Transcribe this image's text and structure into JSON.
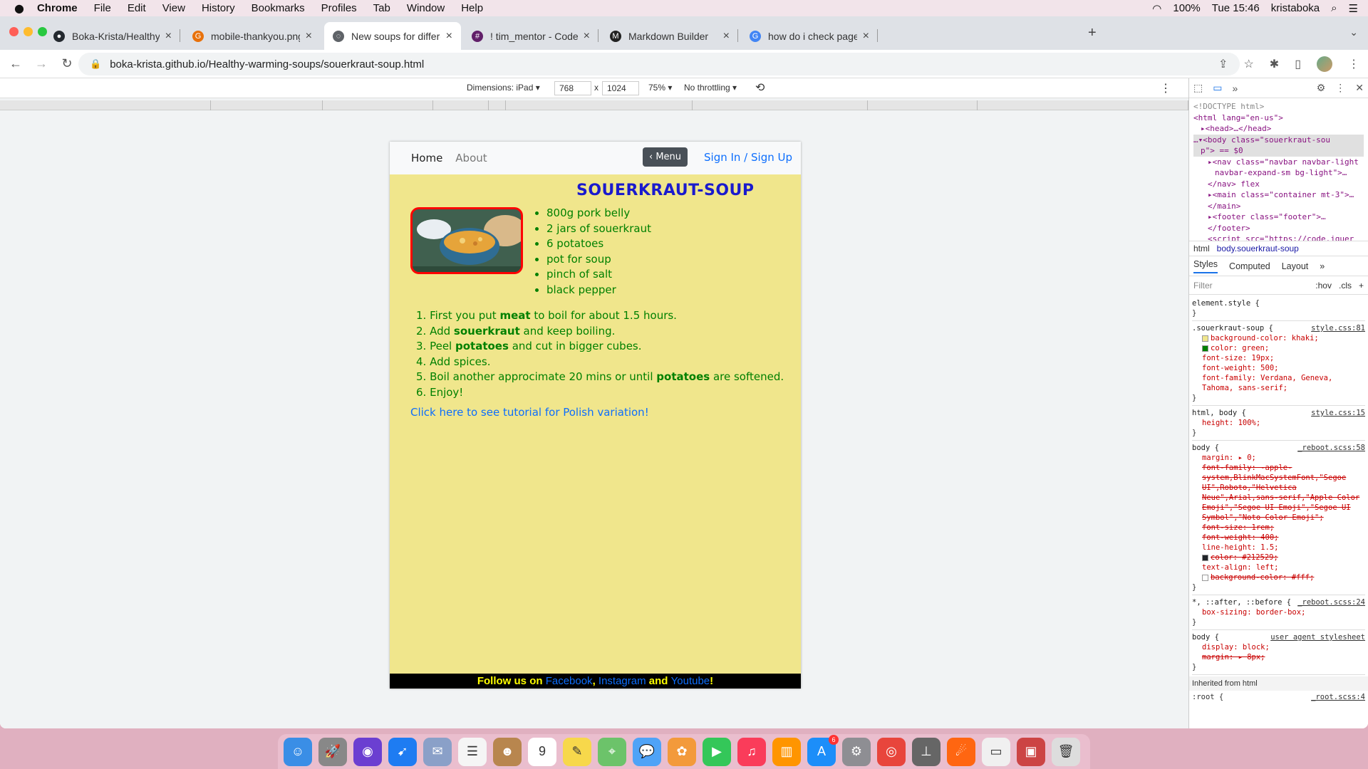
{
  "menubar": {
    "items": [
      "Chrome",
      "File",
      "Edit",
      "View",
      "History",
      "Bookmarks",
      "Profiles",
      "Tab",
      "Window",
      "Help"
    ],
    "battery": "100%",
    "clock": "Tue 15:46",
    "user": "kristaboka"
  },
  "tabs": [
    {
      "title": "Boka-Krista/Healthy-warming-",
      "color": "#24292f",
      "glyph": "●"
    },
    {
      "title": "mobile-thankyou.png — Healt",
      "color": "#e8710a",
      "glyph": "G"
    },
    {
      "title": "New soups for different tastes",
      "color": "#5f6368",
      "glyph": "◌"
    },
    {
      "title": "! tim_mentor - Code Institute -",
      "color": "#611f69",
      "glyph": "#"
    },
    {
      "title": "Markdown Builder",
      "color": "#222",
      "glyph": "M"
    },
    {
      "title": "how do i check page on excel a",
      "color": "#4285f4",
      "glyph": "G"
    }
  ],
  "address": "boka-krista.github.io/Healthy-warming-soups/souerkraut-soup.html",
  "device_bar": {
    "dimensions_label": "Dimensions: iPad ▾",
    "width": "768",
    "times": "x",
    "height": "1024",
    "zoom": "75% ▾",
    "throttling": "No throttling ▾"
  },
  "site": {
    "nav": {
      "home": "Home",
      "about": "About",
      "menu": "‹ Menu",
      "sign": "Sign In / Sign Up"
    },
    "title": "SOUERKRAUT-SOUP",
    "ingredients": [
      "800g pork belly",
      "2 jars of souerkraut",
      "6 potatoes",
      "pot for soup",
      "pinch of salt",
      "black pepper"
    ],
    "steps": [
      {
        "n": "1.",
        "pre": "First you put ",
        "bold": "meat",
        "post": " to boil for about 1.5 hours."
      },
      {
        "n": "2.",
        "pre": "Add ",
        "bold": "souerkraut",
        "post": " and keep boiling."
      },
      {
        "n": "3.",
        "pre": "Peel ",
        "bold": "potatoes",
        "post": " and cut in bigger cubes."
      },
      {
        "n": "4.",
        "pre": "Add spices.",
        "bold": "",
        "post": ""
      },
      {
        "n": "5.",
        "pre": "Boil another approcimate 20 mins or until ",
        "bold": "potatoes",
        "post": " are softened."
      },
      {
        "n": "6.",
        "pre": "Enjoy!",
        "bold": "",
        "post": ""
      }
    ],
    "polish_link": "Click here to see tutorial for Polish variation!",
    "footer": {
      "pre": "Follow us on ",
      "fb": "Facebook",
      "comma": ", ",
      "ig": "Instagram",
      "and": " and ",
      "yt": "Youtube",
      "bang": "!"
    }
  },
  "devtools": {
    "dom": [
      "<!DOCTYPE html>",
      "<html lang=\"en-us\">",
      "▸<head>…</head>",
      "…▾<body class=\"souerkraut-sou",
      "p\"> == $0",
      "▸<nav class=\"navbar navbar-light",
      "navbar-expand-sm bg-light\">…",
      "</nav> flex",
      "▸<main class=\"container mt-3\">…",
      "</main>",
      "▸<footer class=\"footer\">…",
      "</footer>",
      "<script src=\"https://code.jquer"
    ],
    "crumbs": [
      "html",
      "body.souerkraut-soup"
    ],
    "subtabs": [
      "Styles",
      "Computed",
      "Layout",
      "»"
    ],
    "filter_placeholder": "Filter",
    "hov": ":hov",
    "cls": ".cls",
    "rules": [
      {
        "sel": "element.style {",
        "src": "",
        "props": []
      },
      {
        "sel": ".souerkraut-soup {",
        "src": "style.css:81",
        "props": [
          {
            "t": "background-color: khaki;",
            "swatch": "#f0e68c",
            "strike": false
          },
          {
            "t": "color: green;",
            "swatch": "#008000",
            "strike": false
          },
          {
            "t": "font-size: 19px;",
            "swatch": "",
            "strike": false
          },
          {
            "t": "font-weight: 500;",
            "swatch": "",
            "strike": false
          },
          {
            "t": "font-family: Verdana, Geneva, Tahoma, sans-serif;",
            "swatch": "",
            "strike": false
          }
        ]
      },
      {
        "sel": "html, body {",
        "src": "style.css:15",
        "props": [
          {
            "t": "height: 100%;",
            "swatch": "",
            "strike": false
          }
        ]
      },
      {
        "sel": "body {",
        "src": "_reboot.scss:58",
        "props": [
          {
            "t": "margin: ▸ 0;",
            "swatch": "",
            "strike": false
          },
          {
            "t": "font-family: -apple-system,BlinkMacSystemFont,\"Segoe UI\",Roboto,\"Helvetica Neue\",Arial,sans-serif,\"Apple Color Emoji\",\"Segoe UI Emoji\",\"Segoe UI Symbol\",\"Noto Color Emoji\";",
            "swatch": "",
            "strike": true
          },
          {
            "t": "font-size: 1rem;",
            "swatch": "",
            "strike": true
          },
          {
            "t": "font-weight: 400;",
            "swatch": "",
            "strike": true
          },
          {
            "t": "line-height: 1.5;",
            "swatch": "",
            "strike": false
          },
          {
            "t": "color: #212529;",
            "swatch": "#212529",
            "strike": true
          },
          {
            "t": "text-align: left;",
            "swatch": "",
            "strike": false
          },
          {
            "t": "background-color: #fff;",
            "swatch": "#ffffff",
            "strike": true
          }
        ]
      },
      {
        "sel": "*, ::after, ::before {",
        "src": "_reboot.scss:24",
        "props": [
          {
            "t": "box-sizing: border-box;",
            "swatch": "",
            "strike": false
          }
        ]
      },
      {
        "sel": "body {",
        "src": "user agent stylesheet",
        "props": [
          {
            "t": "display: block;",
            "swatch": "",
            "strike": false
          },
          {
            "t": "margin: ▸ 8px;",
            "swatch": "",
            "strike": true
          }
        ]
      }
    ],
    "inherited": "Inherited from html",
    "root": ":root {",
    "root_src": "_root.scss:4"
  },
  "dock": {
    "items": [
      {
        "name": "finder-icon",
        "color": "#3a8ee6",
        "glyph": "☺"
      },
      {
        "name": "launchpad-icon",
        "color": "#888",
        "glyph": "🚀"
      },
      {
        "name": "siri-icon",
        "color": "#6b3fd1",
        "glyph": "◉"
      },
      {
        "name": "safari-icon",
        "color": "#1e7cf2",
        "glyph": "➹"
      },
      {
        "name": "mail-icon",
        "color": "#8aa0c8",
        "glyph": "✉"
      },
      {
        "name": "reminders-icon",
        "color": "#f5f5f5",
        "glyph": "☰"
      },
      {
        "name": "contacts-icon",
        "color": "#b8864e",
        "glyph": "☻"
      },
      {
        "name": "calendar-icon",
        "color": "#ffffff",
        "glyph": "9"
      },
      {
        "name": "notes-icon",
        "color": "#f7d84b",
        "glyph": "✎"
      },
      {
        "name": "maps-icon",
        "color": "#6cc36a",
        "glyph": "⌖"
      },
      {
        "name": "messages-icon",
        "color": "#4fa3f7",
        "glyph": "💬"
      },
      {
        "name": "photos-icon",
        "color": "#f39a3b",
        "glyph": "✿"
      },
      {
        "name": "facetime-icon",
        "color": "#34c759",
        "glyph": "▶"
      },
      {
        "name": "music-icon",
        "color": "#fa3c5a",
        "glyph": "♫"
      },
      {
        "name": "books-icon",
        "color": "#ff9500",
        "glyph": "▥"
      },
      {
        "name": "appstore-icon",
        "color": "#1c8ef9",
        "glyph": "A"
      },
      {
        "name": "settings-icon",
        "color": "#8e8e93",
        "glyph": "⚙"
      },
      {
        "name": "chrome-icon",
        "color": "#e8453c",
        "glyph": "◎"
      },
      {
        "name": "utility-icon",
        "color": "#666",
        "glyph": "⊥"
      },
      {
        "name": "firefox-icon",
        "color": "#ff6611",
        "glyph": "☄"
      },
      {
        "name": "folder-icon",
        "color": "#f0f0f0",
        "glyph": "▭"
      },
      {
        "name": "preview-icon",
        "color": "#c44",
        "glyph": "▣"
      },
      {
        "name": "trash-icon",
        "color": "#ddd",
        "glyph": "🗑"
      }
    ],
    "appstore_badge": "6"
  }
}
